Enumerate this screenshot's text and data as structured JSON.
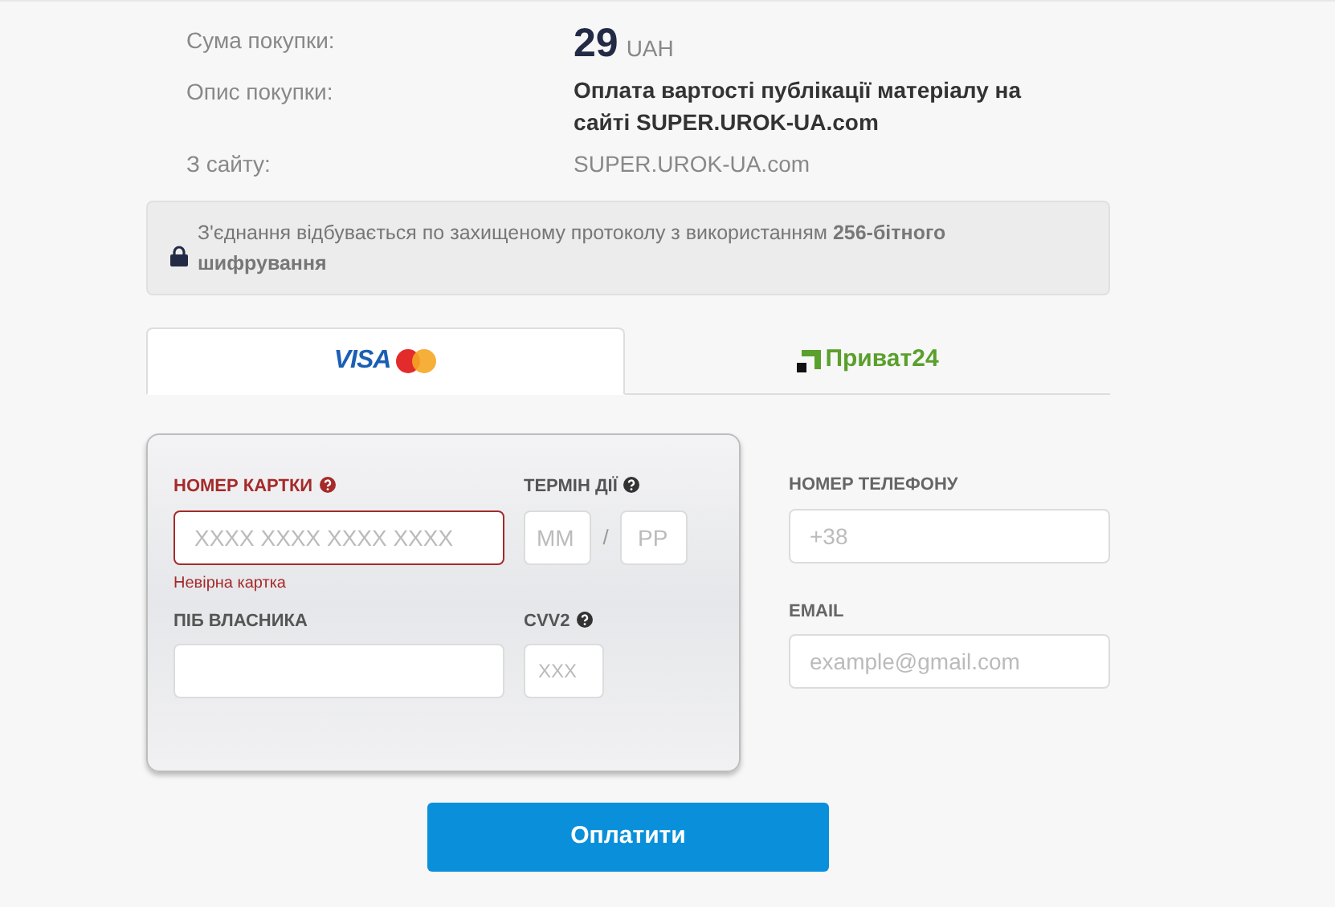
{
  "summary": [
    {
      "label": "Сума покупки:",
      "kind": "amount",
      "value": "29",
      "unit": "UAH"
    },
    {
      "label": "Опис покупки:",
      "kind": "bold",
      "value": "Оплата вартості публікації матеріалу на сайті SUPER.UROK-UA.com"
    },
    {
      "label": "З сайту:",
      "kind": "plain",
      "value": "SUPER.UROK-UA.com"
    }
  ],
  "security_notice": "З'єднання відбувається по захищеному протоколу з використанням **256-бітного шифрування**",
  "tabs": [
    {
      "kind": "cards",
      "label": "VISA",
      "selected": true
    },
    {
      "kind": "privat",
      "label": "Приват24",
      "selected": false
    }
  ],
  "card_form": {
    "card_number": {
      "label": "НОМЕР КАРТКИ",
      "placeholder": "XXXX XXXX XXXX XXXX",
      "invalid": true,
      "error": "Невірна картка"
    },
    "expiry": {
      "label": "ТЕРМІН ДІЇ",
      "month_placeholder": "ММ",
      "separator": "/",
      "year_placeholder": "РР"
    },
    "holder": {
      "label": "ПІБ ВЛАСНИКА"
    },
    "cvv": {
      "label": "CVV2",
      "placeholder": "XXX"
    }
  },
  "contact": [
    {
      "label": "НОМЕР ТЕЛЕФОНУ",
      "placeholder": "+38"
    },
    {
      "label": "EMAIL",
      "placeholder": "example@gmail.com"
    }
  ],
  "pay_button": "Оплатити"
}
